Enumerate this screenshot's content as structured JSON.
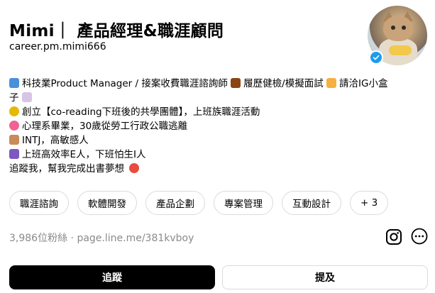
{
  "profile": {
    "display_name": "Mimi｜ 產品經理&職涯顧問",
    "username": "career.pm.mimi666",
    "verified": true
  },
  "bio": {
    "line1": "科技業Product Manager / 接案收費職涯諮詢師",
    "line1b": "履歷健檢/模擬面試",
    "line1c": "請洽IG小盒",
    "line1d": "子",
    "line2": "創立【co-reading下班後的共學團體】，上班族職涯活動",
    "line3": "心理系畢業，30歲從勞工行政公職逃離",
    "line4": "INTJ，高敏感人",
    "line5": "上班高效率E人，下班怕生I人",
    "line6": "追蹤我，幫我完成出書夢想",
    "emoji_colors": {
      "laptop": "#4a90d9",
      "briefcase": "#8b4513",
      "hand": "#f5b041",
      "envelope": "#d7c4e6",
      "sunflower": "#e6b800",
      "blossom": "#f06292",
      "meditate": "#c98b5a",
      "robot": "#7e57c2",
      "heart_face": "#e74c3c"
    }
  },
  "tags": [
    "職涯諮詢",
    "軟體開發",
    "產品企劃",
    "專案管理",
    "互動設計",
    "+ 3"
  ],
  "stats": {
    "followers": "3,986位粉絲",
    "separator": "·",
    "link": "page.line.me/381kvboy"
  },
  "buttons": {
    "follow": "追蹤",
    "mention": "提及"
  },
  "colors": {
    "primary_button": "#000000",
    "verified_badge": "#1d9bf0",
    "muted_text": "#8a8a8a"
  }
}
